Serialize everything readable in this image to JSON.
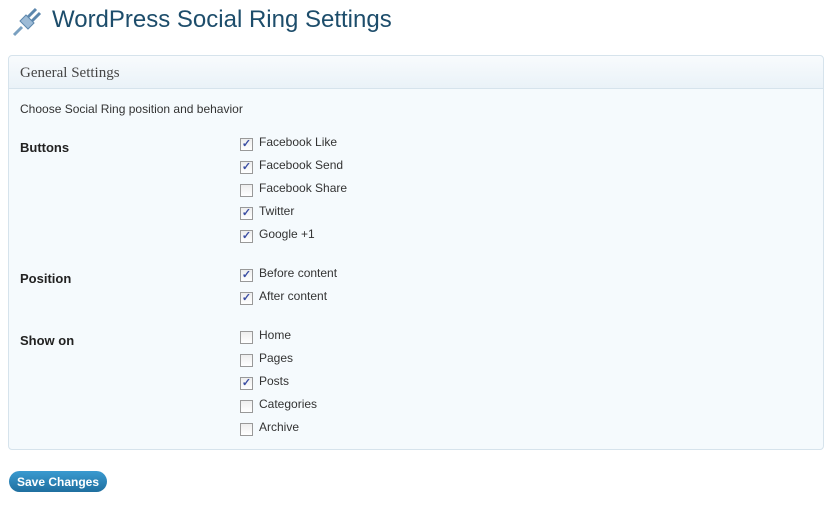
{
  "page": {
    "title": "WordPress Social Ring Settings"
  },
  "panel": {
    "title": "General Settings",
    "description": "Choose Social Ring position and behavior"
  },
  "sections": [
    {
      "label": "Buttons",
      "options": [
        {
          "label": "Facebook Like",
          "checked": true
        },
        {
          "label": "Facebook Send",
          "checked": true
        },
        {
          "label": "Facebook Share",
          "checked": false
        },
        {
          "label": "Twitter",
          "checked": true
        },
        {
          "label": "Google +1",
          "checked": true
        }
      ]
    },
    {
      "label": "Position",
      "options": [
        {
          "label": "Before content",
          "checked": true
        },
        {
          "label": "After content",
          "checked": true
        }
      ]
    },
    {
      "label": "Show on",
      "options": [
        {
          "label": "Home",
          "checked": false
        },
        {
          "label": "Pages",
          "checked": false
        },
        {
          "label": "Posts",
          "checked": true
        },
        {
          "label": "Categories",
          "checked": false
        },
        {
          "label": "Archive",
          "checked": false
        }
      ]
    }
  ],
  "save_label": "Save Changes"
}
